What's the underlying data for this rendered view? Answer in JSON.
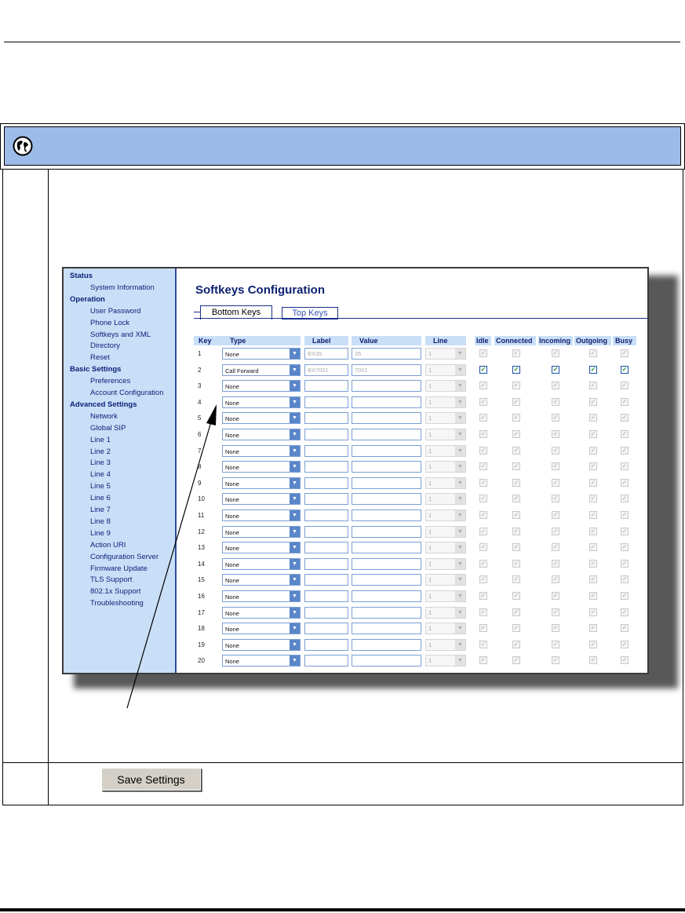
{
  "sidebar": {
    "sections": [
      {
        "heading": "Status",
        "items": [
          "System Information"
        ]
      },
      {
        "heading": "Operation",
        "items": [
          "User Password",
          "Phone Lock",
          "Softkeys and XML",
          "Directory",
          "Reset"
        ]
      },
      {
        "heading": "Basic Settings",
        "items": [
          "Preferences",
          "Account Configuration"
        ]
      },
      {
        "heading": "Advanced Settings",
        "items": [
          "Network",
          "Global SIP",
          "Line 1",
          "Line 2",
          "Line 3",
          "Line 4",
          "Line 5",
          "Line 6",
          "Line 7",
          "Line 8",
          "Line 9",
          "Action URI",
          "Configuration Server",
          "Firmware Update",
          "TLS Support",
          "802.1x Support",
          "Troubleshooting"
        ]
      }
    ]
  },
  "page": {
    "title": "Softkeys Configuration",
    "tabs": [
      "Bottom Keys",
      "Top Keys"
    ],
    "active_tab": "Bottom Keys"
  },
  "table": {
    "headers": {
      "key": "Key",
      "type": "Type",
      "label": "Label",
      "value": "Value",
      "line": "Line",
      "idle": "Idle",
      "connected": "Connected",
      "incoming": "Incoming",
      "outgoing": "Outgoing",
      "busy": "Busy"
    },
    "rows": [
      {
        "key": "1",
        "type": "None",
        "label": "BX35",
        "value": "35",
        "line": "1",
        "checked": false
      },
      {
        "key": "2",
        "type": "Call Forward",
        "label": "BX7001",
        "value": "7001",
        "line": "1",
        "checked": true
      },
      {
        "key": "3",
        "type": "None",
        "label": "",
        "value": "",
        "line": "1",
        "checked": false
      },
      {
        "key": "4",
        "type": "None",
        "label": "",
        "value": "",
        "line": "1",
        "checked": false
      },
      {
        "key": "5",
        "type": "None",
        "label": "",
        "value": "",
        "line": "1",
        "checked": false
      },
      {
        "key": "6",
        "type": "None",
        "label": "",
        "value": "",
        "line": "1",
        "checked": false
      },
      {
        "key": "7",
        "type": "None",
        "label": "",
        "value": "",
        "line": "1",
        "checked": false
      },
      {
        "key": "8",
        "type": "None",
        "label": "",
        "value": "",
        "line": "1",
        "checked": false
      },
      {
        "key": "9",
        "type": "None",
        "label": "",
        "value": "",
        "line": "1",
        "checked": false
      },
      {
        "key": "10",
        "type": "None",
        "label": "",
        "value": "",
        "line": "1",
        "checked": false
      },
      {
        "key": "11",
        "type": "None",
        "label": "",
        "value": "",
        "line": "1",
        "checked": false
      },
      {
        "key": "12",
        "type": "None",
        "label": "",
        "value": "",
        "line": "1",
        "checked": false
      },
      {
        "key": "13",
        "type": "None",
        "label": "",
        "value": "",
        "line": "1",
        "checked": false
      },
      {
        "key": "14",
        "type": "None",
        "label": "",
        "value": "",
        "line": "1",
        "checked": false
      },
      {
        "key": "15",
        "type": "None",
        "label": "",
        "value": "",
        "line": "1",
        "checked": false
      },
      {
        "key": "16",
        "type": "None",
        "label": "",
        "value": "",
        "line": "1",
        "checked": false
      },
      {
        "key": "17",
        "type": "None",
        "label": "",
        "value": "",
        "line": "1",
        "checked": false
      },
      {
        "key": "18",
        "type": "None",
        "label": "",
        "value": "",
        "line": "1",
        "checked": false
      },
      {
        "key": "19",
        "type": "None",
        "label": "",
        "value": "",
        "line": "1",
        "checked": false
      },
      {
        "key": "20",
        "type": "None",
        "label": "",
        "value": "",
        "line": "1",
        "checked": false
      }
    ]
  },
  "save_button": {
    "label": "Save Settings"
  },
  "icons": {
    "banner": "globe-icon",
    "dropdown": "chevron-down-icon",
    "checkbox": "checkmark-icon"
  },
  "colors": {
    "banner": "#9dbbe9",
    "sidebar": "#c9dff7",
    "heading": "#0b1f6f",
    "check": "#1a8a2a"
  }
}
